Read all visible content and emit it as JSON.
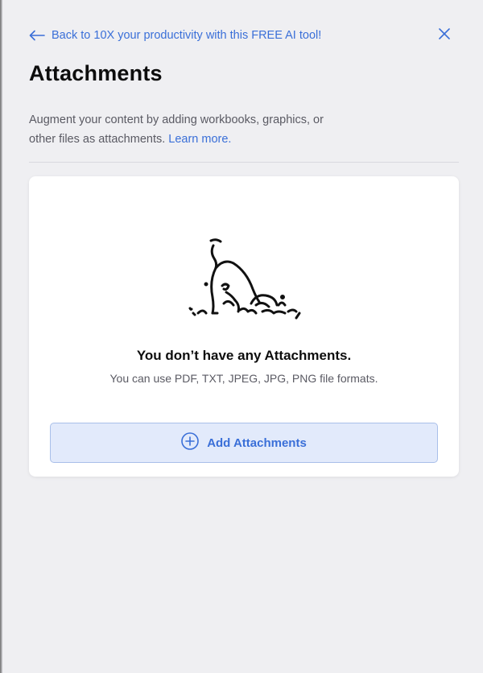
{
  "header": {
    "back_label": "Back to 10X your productivity with this FREE AI tool!",
    "back_icon": "arrow-left-icon",
    "close_icon": "close-icon"
  },
  "page": {
    "title": "Attachments",
    "description": "Augment your content by adding workbooks, graphics, or other files as attachments.",
    "learn_more": "Learn more."
  },
  "empty_state": {
    "illustration": "dog-digging-illustration",
    "title": "You don’t have any Attachments.",
    "subtitle": "You can use PDF, TXT, JPEG, JPG, PNG file formats."
  },
  "actions": {
    "add_label": "Add Attachments",
    "add_icon": "plus-circle-icon"
  },
  "colors": {
    "accent": "#3a6fd8",
    "background": "#efeff2",
    "button_bg": "#e2eafb"
  }
}
